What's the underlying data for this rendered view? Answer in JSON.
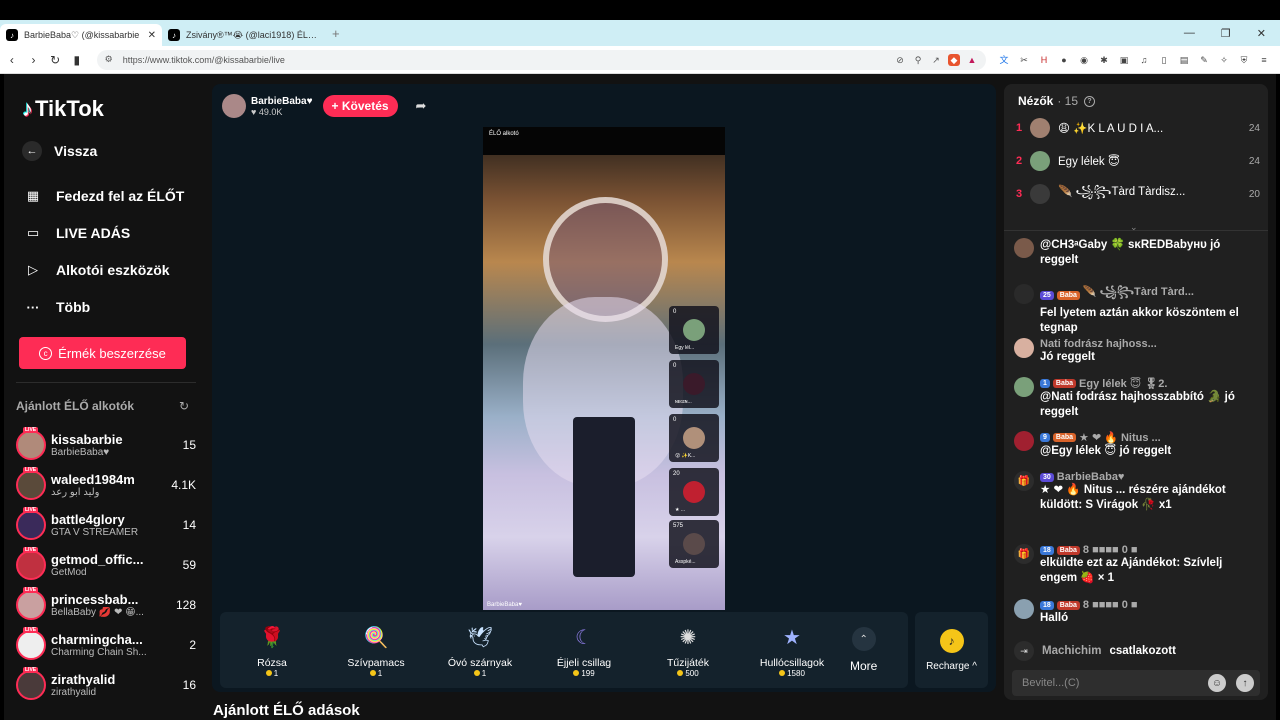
{
  "browser": {
    "tabs": [
      {
        "label": "BarbieBaba♡ (@kissabarbie",
        "close": "✕"
      },
      {
        "label": "Zsivány®™😭 (@laci1918) ÉLŐ adás",
        "close": ""
      }
    ],
    "new_tab": "+",
    "url": "https://www.tiktok.com/@kissabarbie/live"
  },
  "sidebar": {
    "logo": "TikTok",
    "nav": [
      {
        "label": "Vissza",
        "icon": "back-arrow-icon"
      },
      {
        "label": "Fedezd fel az ÉLŐT",
        "icon": "calendar-icon"
      },
      {
        "label": "LIVE ADÁS",
        "icon": "camera-icon"
      },
      {
        "label": "Alkotói eszközök",
        "icon": "play-icon"
      },
      {
        "label": "Több",
        "icon": "more-icon"
      }
    ],
    "coin_button": "Érmék beszerzése",
    "suggested_title": "Ajánlott ÉLŐ alkotók",
    "creators": [
      {
        "name": "kissabarbie",
        "sub": "BarbieBaba♥",
        "count": "15"
      },
      {
        "name": "waleed1984m",
        "sub": "وليد ابو رعد",
        "count": "4.1K"
      },
      {
        "name": "battle4glory",
        "sub": "GTA V STREAMER",
        "count": "14"
      },
      {
        "name": "getmod_offic...",
        "sub": "GetMod",
        "count": "59"
      },
      {
        "name": "princessbab...",
        "sub": "BellaBaby 💋 ❤ 😁...",
        "count": "128"
      },
      {
        "name": "charmingcha...",
        "sub": "Charming Chain Sh...",
        "count": "2"
      },
      {
        "name": "zirathyalid",
        "sub": "zirathyalid",
        "count": "16"
      }
    ]
  },
  "stream": {
    "host_name": "BarbieBaba♥",
    "host_likes": "♥ 49.0K",
    "follow": "+ Követés",
    "video_top_label": "ÉLŐ alkotó",
    "video_bottom_label": "BarbieBaba♥",
    "mini_cards": [
      {
        "count": "0",
        "name": "Egy lél..."
      },
      {
        "count": "0",
        "name": "ɴᴇɢɪɴ..."
      },
      {
        "count": "0",
        "name": "😮 ✨K..."
      },
      {
        "count": "20",
        "name": "★ ..."
      },
      {
        "count": "575",
        "name": "Asspké..."
      }
    ],
    "gifts": [
      {
        "name": "Rózsa",
        "price": "1",
        "icon": "🌹",
        "color": "#d62b3a"
      },
      {
        "name": "Szívpamacs",
        "price": "1",
        "icon": "🍭",
        "color": "#f4a3c6"
      },
      {
        "name": "Óvó szárnyak",
        "price": "1",
        "icon": "🪽",
        "color": "#c9e3ff"
      },
      {
        "name": "Éjjeli csillag",
        "price": "199",
        "icon": "🌙",
        "color": "#6a5acd"
      },
      {
        "name": "Tűzijáték",
        "price": "500",
        "icon": "✨",
        "color": "#dddddd"
      },
      {
        "name": "Hullócsillagok",
        "price": "1580",
        "icon": "⭐",
        "color": "#9fb3ff"
      }
    ],
    "more": "More",
    "recharge": "Recharge ^",
    "bottom_title": "Ajánlott ÉLŐ adások"
  },
  "chat": {
    "viewers_title": "Nézők",
    "viewers_count": "· 15",
    "top_viewers": [
      {
        "rank": "1",
        "name": "😩 ✨K L A U D I A...",
        "score": "24"
      },
      {
        "rank": "2",
        "name": "Egy lélek 😇",
        "score": "24"
      },
      {
        "rank": "3",
        "name": "🪶 ꧁꧂Tàrd Tàrdisz...",
        "score": "20"
      }
    ],
    "messages": [
      {
        "user": "@CH3ᵃGaby 🍀 sᴋREDBabyʜᴜ jó",
        "text": "reggelt",
        "level": "",
        "fan": ""
      },
      {
        "user": "🪶 ꧁꧂Tàrd Tàrd...",
        "text": "Fel lyetem aztán akkor köszöntem el tegnap",
        "level": "25",
        "fan": "Baba"
      },
      {
        "user": "Nati fodrász hajhoss...",
        "text": "Jó reggelt",
        "level": "",
        "fan": ""
      },
      {
        "user": "Egy lélek 😇 🎖2.",
        "text": "@Nati fodrász hajhosszabbító 🐊 jó reggelt",
        "level": "1",
        "fan": "Baba"
      },
      {
        "user": "★ ❤ 🔥 Nitus ...",
        "text": "@Egy lélek 😇 jó reggelt",
        "level": "9",
        "fan": "Baba"
      },
      {
        "user": "BarbieBaba♥",
        "text": "★ ❤ 🔥 Nitus ... részére ajándékot küldött: S Virágok 🥀 x1",
        "level": "30",
        "fan": ""
      },
      {
        "user": "8 ■■■■ 0 ■",
        "text": "elküldte ezt az Ajándékot: Szívlelj engem 🍓 × 1",
        "level": "18",
        "fan": "Baba"
      },
      {
        "user": "8 ■■■■ 0 ■",
        "text": "Halló",
        "level": "18",
        "fan": "Baba"
      }
    ],
    "join_name": "Machichim",
    "join_text": "csatlakozott",
    "input_placeholder": "Bevitel...(C)"
  }
}
